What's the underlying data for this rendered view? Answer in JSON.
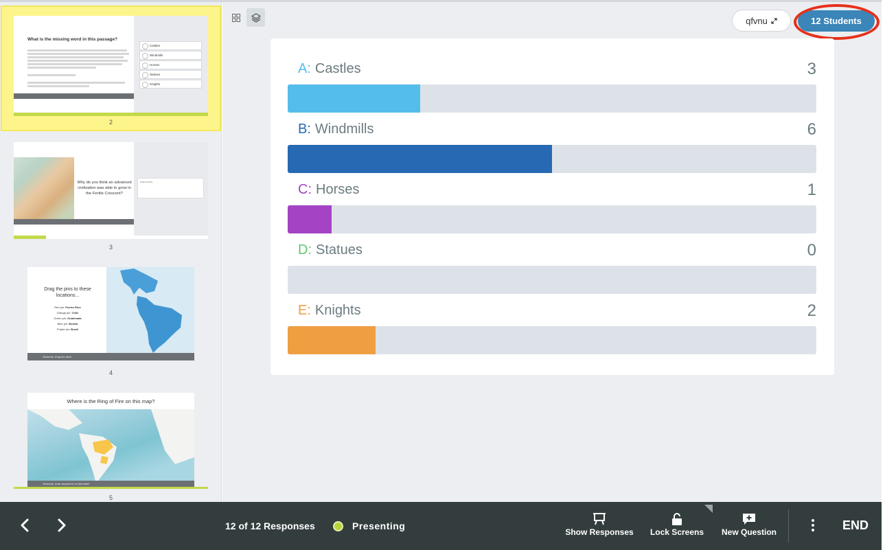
{
  "sidebar": {
    "slides": [
      {
        "number": "2",
        "title": "What is the missing word in this passage?",
        "options": [
          "Castles",
          "Windmills",
          "Horses",
          "Statues",
          "Knights"
        ]
      },
      {
        "number": "3",
        "title": "Why do you think an advanced civilization was able to grow in the Fertile Crescent?",
        "box_label": "Student Work"
      },
      {
        "number": "4",
        "title": "Drag the pins to these locations...",
        "pins": [
          {
            "label": "Red pin:",
            "place": "Puerto Rico"
          },
          {
            "label": "Orange pin:",
            "place": "Chile"
          },
          {
            "label": "Green pin:",
            "place": "Guatemala"
          },
          {
            "label": "Blue pin:",
            "place": "Bolivia"
          },
          {
            "label": "Purple pin:",
            "place": "Brazil"
          }
        ],
        "footer": "Students, drag the pins!"
      },
      {
        "number": "5",
        "title": "Where is the Ring of Fire on this map?",
        "footer": "Students, draw anywhere on this slide!"
      }
    ]
  },
  "header": {
    "class_code": "qfvnu",
    "students_label": "12 Students"
  },
  "results": {
    "answers": [
      {
        "letter": "A:",
        "label": "Castles",
        "count": "3",
        "value": 3,
        "color": "#55bdea"
      },
      {
        "letter": "B:",
        "label": "Windmills",
        "count": "6",
        "value": 6,
        "color": "#2769b2"
      },
      {
        "letter": "C:",
        "label": "Horses",
        "count": "1",
        "value": 1,
        "color": "#a444c4"
      },
      {
        "letter": "D:",
        "label": "Statues",
        "count": "0",
        "value": 0,
        "color": "#64c56e"
      },
      {
        "letter": "E:",
        "label": "Knights",
        "count": "2",
        "value": 2,
        "color": "#ef9e42"
      }
    ],
    "total": 12
  },
  "bottom_bar": {
    "responses": "12 of 12 Responses",
    "status": "Presenting",
    "show_responses": "Show Responses",
    "lock_screens": "Lock Screens",
    "new_question": "New Question",
    "end": "END"
  }
}
